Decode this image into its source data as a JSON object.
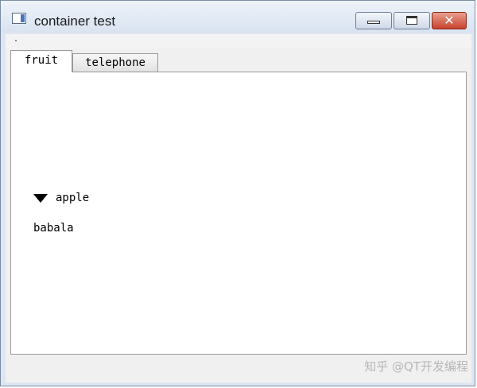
{
  "window": {
    "title": "container test",
    "controls": {
      "minimize_icon": "minimize-icon",
      "maximize_icon": "maximize-icon",
      "close_label": "✕"
    }
  },
  "tabs": [
    {
      "label": "fruit",
      "active": true
    },
    {
      "label": "telephone",
      "active": false
    }
  ],
  "tree": {
    "parent": {
      "label": "apple",
      "expanded": true,
      "icon": "triangle-down-icon"
    },
    "child": {
      "label": "babala"
    }
  },
  "watermark": "知乎 @QT开发编程",
  "colors": {
    "close_button": "#c8422d",
    "titlebar": "#dfe6f1"
  }
}
